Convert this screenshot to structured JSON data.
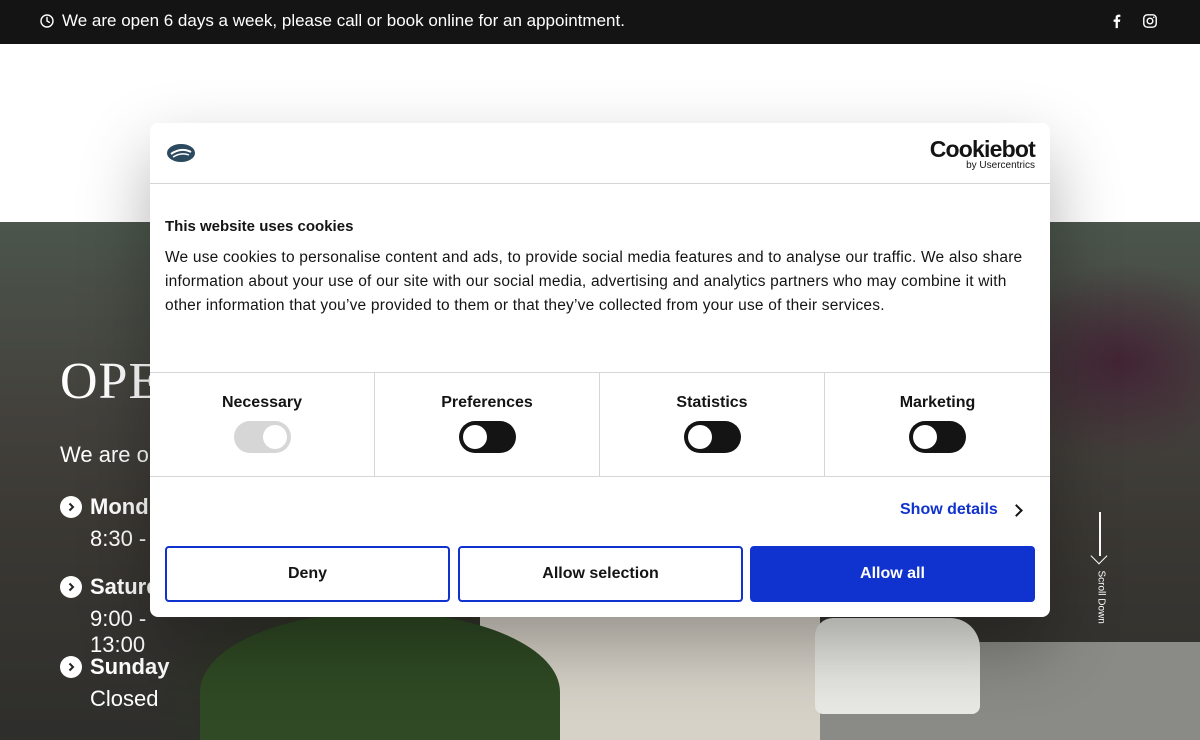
{
  "topbar": {
    "message": "We are open 6 days a week, please call or book online for an appointment.",
    "social_icons": [
      "facebook-icon",
      "instagram-icon"
    ]
  },
  "hero": {
    "title": "OPE",
    "subtitle": "We are op",
    "hours": [
      {
        "day": "Mond",
        "time": "8:30 -"
      },
      {
        "day": "Saturd",
        "time": "9:00 - 13:00"
      },
      {
        "day": "Sunday",
        "time": "Closed"
      }
    ],
    "scroll_label": "Scroll Down"
  },
  "cookie_dialog": {
    "brand_name": "Cookiebot",
    "brand_by": "by Usercentrics",
    "title": "This website uses cookies",
    "text": "We use cookies to personalise content and ads, to provide social media features and to analyse our traffic. We also share information about your use of our site with our social media, advertising and analytics partners who may combine it with other information that you’ve provided to them or that they’ve collected from your use of their services.",
    "categories": [
      {
        "label": "Necessary",
        "checked": true,
        "disabled": true
      },
      {
        "label": "Preferences",
        "checked": false,
        "disabled": false
      },
      {
        "label": "Statistics",
        "checked": false,
        "disabled": false
      },
      {
        "label": "Marketing",
        "checked": false,
        "disabled": false
      }
    ],
    "show_details": "Show details",
    "buttons": {
      "deny": "Deny",
      "allow_selection": "Allow selection",
      "allow_all": "Allow all"
    },
    "colors": {
      "accent": "#1032cf",
      "text": "#141414",
      "divider": "#d6d6d6"
    }
  }
}
